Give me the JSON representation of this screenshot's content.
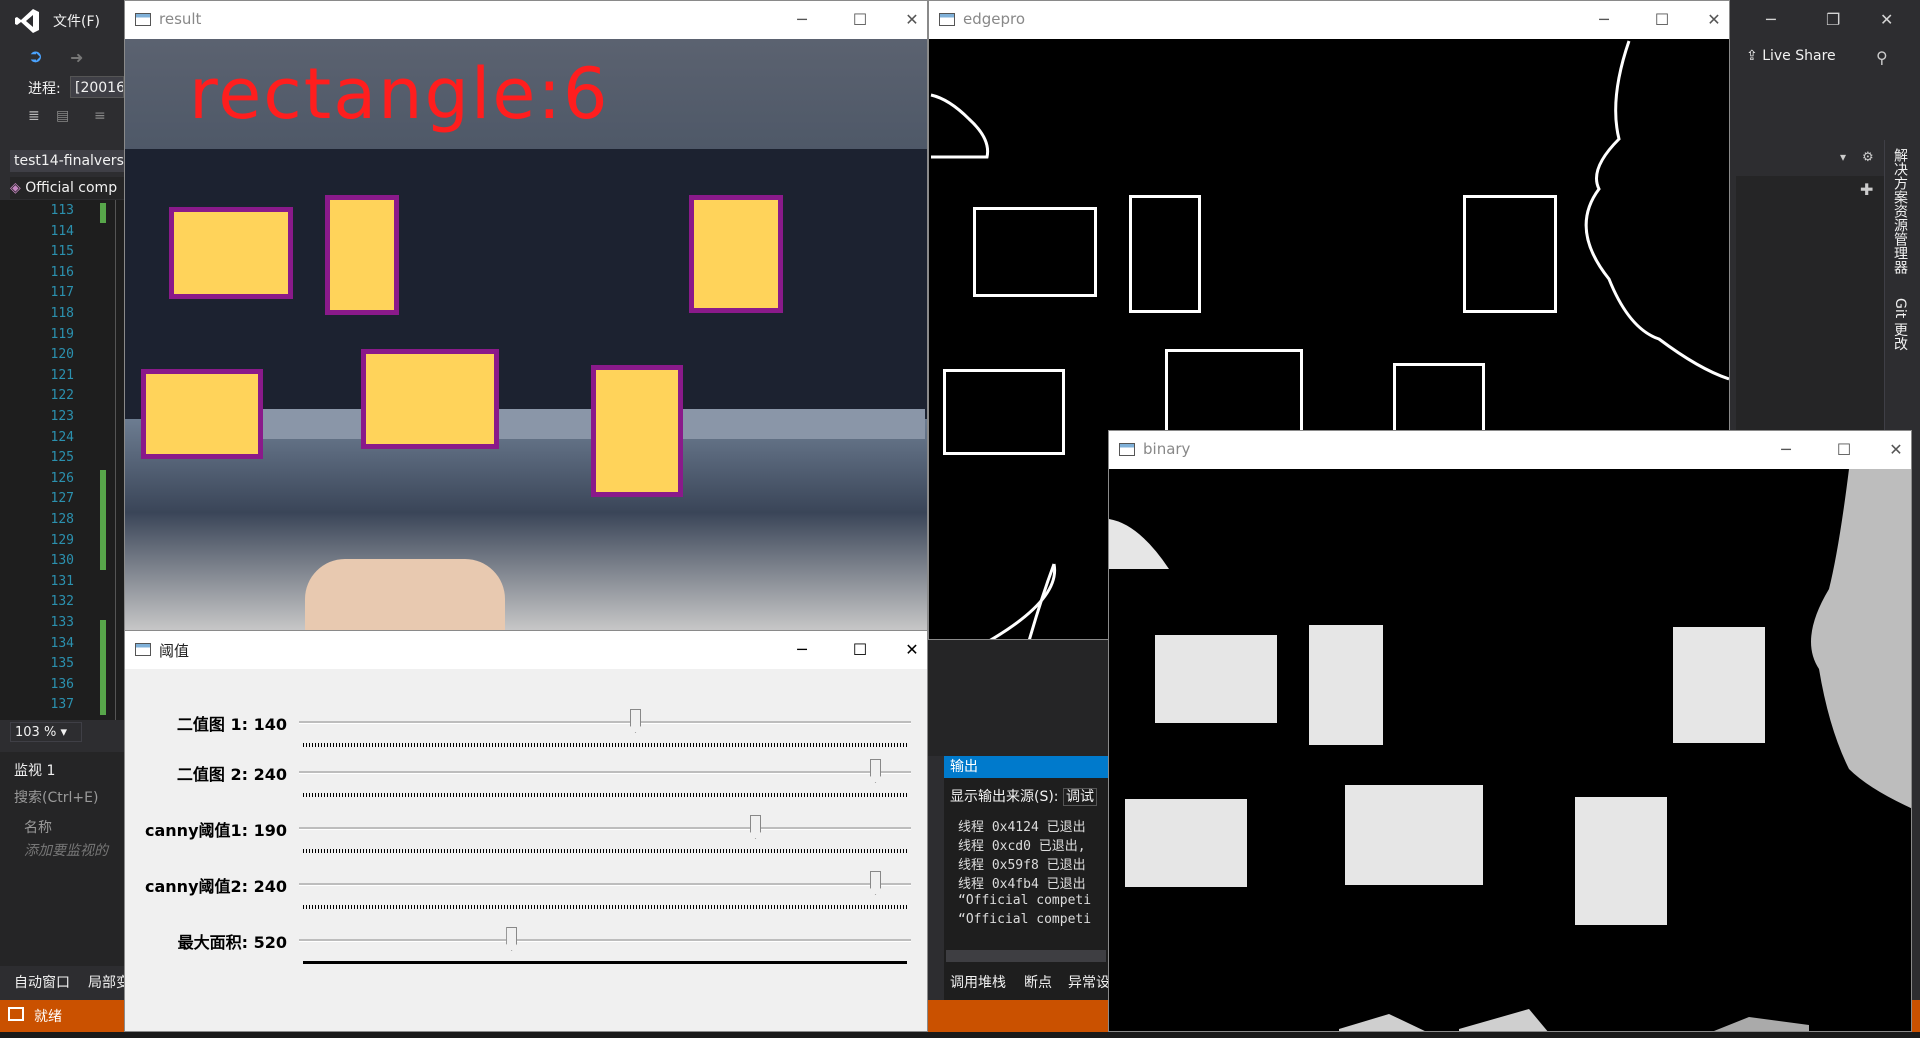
{
  "vs": {
    "menu_file": "文件(F)",
    "process_label": "进程:",
    "process_value": "[20016",
    "doc_tab": "test14-finalvers",
    "nav_combo": "Official comp",
    "line_numbers": [
      "113",
      "114",
      "115",
      "116",
      "117",
      "118",
      "119",
      "120",
      "121",
      "122",
      "123",
      "124",
      "125",
      "126",
      "127",
      "128",
      "129",
      "130",
      "131",
      "132",
      "133",
      "134",
      "135",
      "136",
      "137"
    ],
    "zoom": "103 %",
    "watch_title": "监视 1",
    "watch_search": "搜索(Ctrl+E)",
    "watch_col_name": "名称",
    "watch_add": "添加要监视的",
    "bottom_tab_auto": "自动窗口",
    "bottom_tab_local": "局部变",
    "status": "就绪",
    "live_share": "Live Share",
    "side_solution": "解决方案资源管理器",
    "side_git": "Git 更改",
    "output_title": "输出",
    "output_source_label": "显示输出来源(S):",
    "output_source_value": "调试",
    "output_lines": [
      "线程 0x4124 已退出",
      "线程 0xcd0 已退出,",
      "线程 0x59f8 已退出",
      "线程 0x4fb4 已退出",
      "“Official competi",
      "“Official competi"
    ],
    "out_tab_callstack": "调用堆栈",
    "out_tab_breakpoints": "断点",
    "out_tab_exceptions": "异常设"
  },
  "windows": {
    "result": {
      "title": "result",
      "label": "rectangle:6"
    },
    "edgepro": {
      "title": "edgepro"
    },
    "binary": {
      "title": "binary"
    },
    "threshold": {
      "title": "阈值",
      "trackbars": [
        {
          "label": "二值图 1: 140",
          "value": 140,
          "max": 255
        },
        {
          "label": "二值图 2: 240",
          "value": 240,
          "max": 255
        },
        {
          "label": "canny阈值1: 190",
          "value": 190,
          "max": 255
        },
        {
          "label": "canny阈值2: 240",
          "value": 240,
          "max": 255
        },
        {
          "label": "最大面积: 520",
          "value": 520,
          "max": 1500
        }
      ]
    }
  },
  "colors": {
    "status_bar": "#ca5100",
    "label_red": "#ff1e1e",
    "box_fill": "#ffd35a",
    "box_border": "#8a1a8a"
  }
}
